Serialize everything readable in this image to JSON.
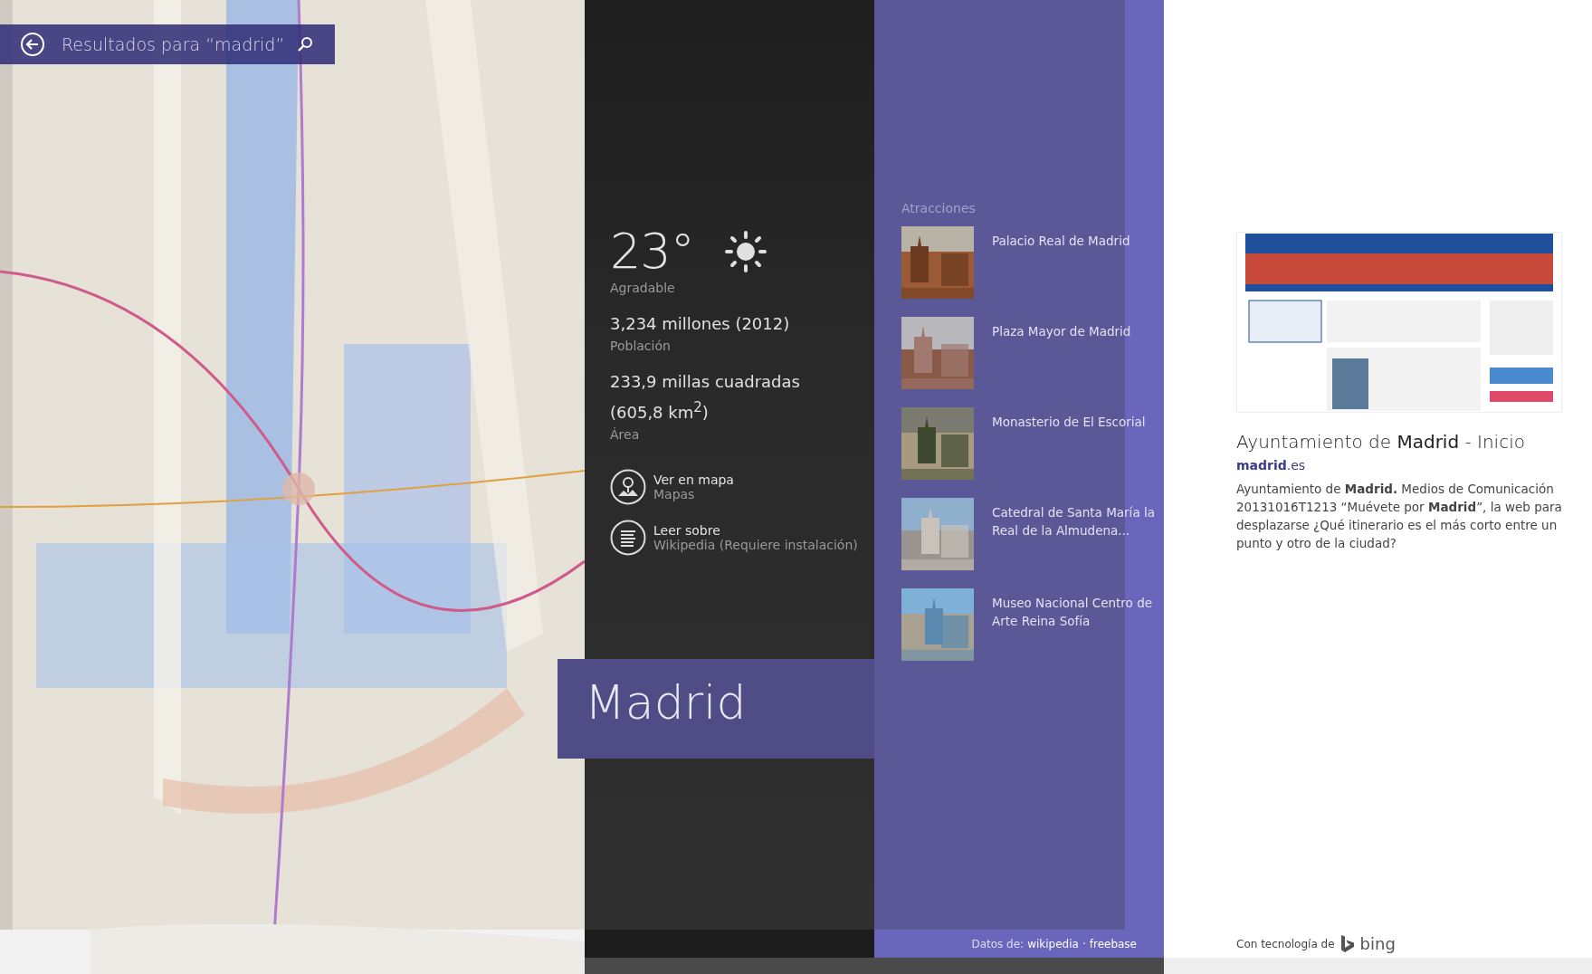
{
  "search_bar": {
    "title": "Resultados para “madrid”"
  },
  "weather": {
    "temperature": "23°",
    "condition": "Agradable"
  },
  "facts": [
    {
      "value": "3,234 millones (2012)",
      "label": "Población"
    },
    {
      "value": "233,9 millas cuadradas (605,8 km$^{2}$)",
      "label": "Área"
    }
  ],
  "actions": [
    {
      "kind": "map",
      "title": "Ver en mapa",
      "subtitle": "Mapas"
    },
    {
      "kind": "read",
      "title": "Leer sobre",
      "subtitle": "Wikipedia (Requiere instalación)"
    }
  ],
  "entity_title": "Madrid",
  "attractions": {
    "heading": "Atracciones",
    "items": [
      {
        "name": "Palacio Real de Madrid"
      },
      {
        "name": "Plaza Mayor de Madrid"
      },
      {
        "name": "Monasterio de El Escorial"
      },
      {
        "name": "Catedral de Santa María la Real de la Almudena..."
      },
      {
        "name": "Museo Nacional Centro de Arte Reina Sofía"
      }
    ]
  },
  "sources": {
    "label": "Datos de:",
    "links": [
      "wikipedia",
      "freebase"
    ],
    "separator": "·"
  },
  "web_result": {
    "title": "Ayuntamiento de **Madrid** - Inicio",
    "url": "**madrid**.es",
    "snippet": "Ayuntamiento de **Madrid.** Medios de Comunicación 20131016T1213 “Muévete por **Madrid**”, la web para desplazarse ¿Qué itinerario es el más corto entre un punto y otro de la ciudad?"
  },
  "powered_by": {
    "label": "Con tecnología de",
    "brand": "bing"
  }
}
